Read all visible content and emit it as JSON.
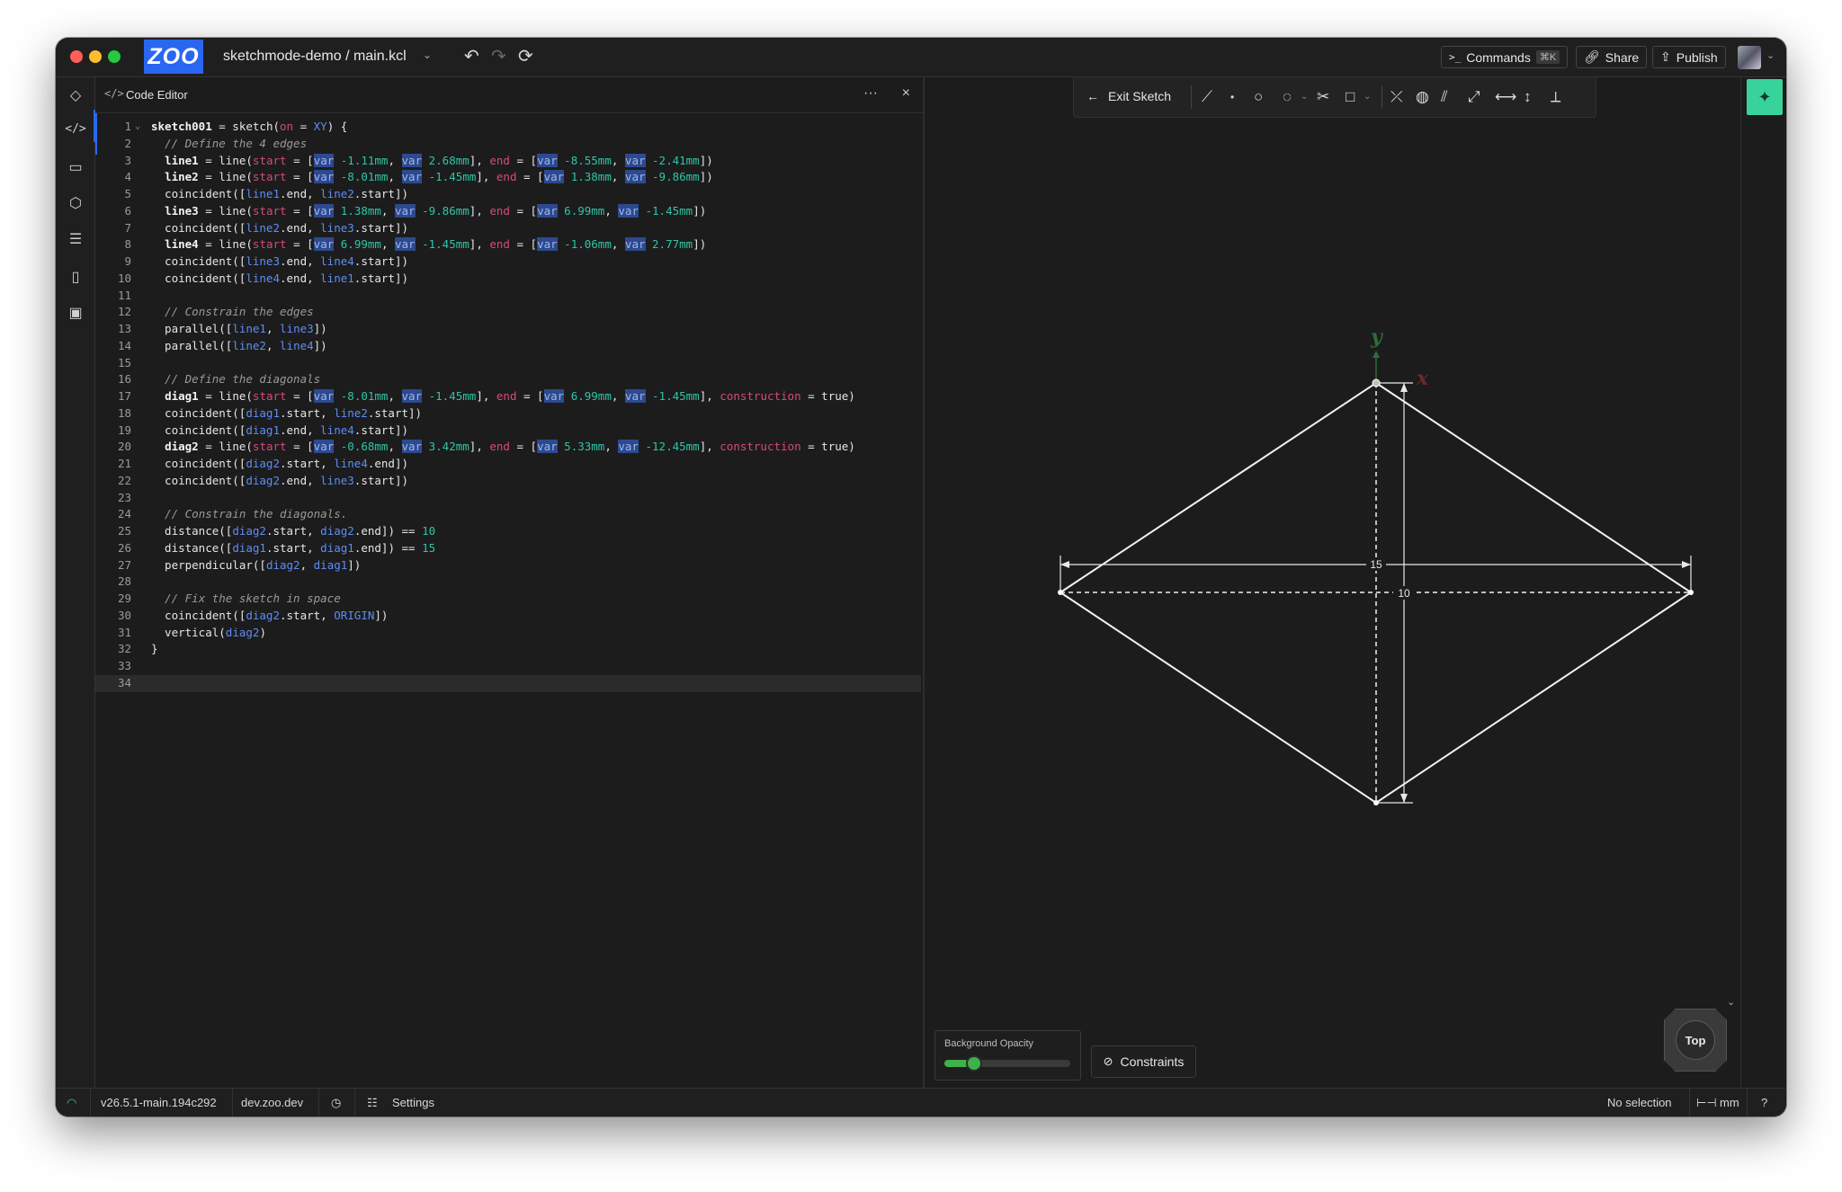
{
  "titlebar": {
    "logo": "ZOO",
    "project_path": "sketchmode-demo / main.kcl",
    "commands_label": "Commands",
    "commands_shortcut": "⌘K",
    "share_label": "Share",
    "publish_label": "Publish"
  },
  "editor": {
    "title": "Code Editor",
    "more": "···",
    "close": "×",
    "lines": [
      {
        "n": "1",
        "fold": "⌄",
        "tokens": [
          [
            "k-name",
            "sketch001"
          ],
          [
            "",
            " = sketch("
          ],
          [
            "k-param",
            "on"
          ],
          [
            "",
            " = "
          ],
          [
            "k-ref",
            "XY"
          ],
          [
            "",
            ") {"
          ]
        ]
      },
      {
        "n": "2",
        "tokens": [
          [
            "",
            "  "
          ],
          [
            "k-com",
            "// Define the 4 edges"
          ]
        ]
      },
      {
        "n": "3",
        "tokens": [
          [
            "",
            "  "
          ],
          [
            "k-name",
            "line1"
          ],
          [
            "",
            " = line("
          ],
          [
            "k-param",
            "start"
          ],
          [
            "",
            " = ["
          ],
          [
            "k-var",
            "var"
          ],
          [
            "k-num",
            " -1.11mm"
          ],
          [
            "",
            ", "
          ],
          [
            "k-var",
            "var"
          ],
          [
            "k-num",
            " 2.68mm"
          ],
          [
            "",
            "], "
          ],
          [
            "k-param",
            "end"
          ],
          [
            "",
            " = ["
          ],
          [
            "k-var",
            "var"
          ],
          [
            "k-num",
            " -8.55mm"
          ],
          [
            "",
            ", "
          ],
          [
            "k-var",
            "var"
          ],
          [
            "k-num",
            " -2.41mm"
          ],
          [
            "",
            "])"
          ]
        ]
      },
      {
        "n": "4",
        "tokens": [
          [
            "",
            "  "
          ],
          [
            "k-name",
            "line2"
          ],
          [
            "",
            " = line("
          ],
          [
            "k-param",
            "start"
          ],
          [
            "",
            " = ["
          ],
          [
            "k-var",
            "var"
          ],
          [
            "k-num",
            " -8.01mm"
          ],
          [
            "",
            ", "
          ],
          [
            "k-var",
            "var"
          ],
          [
            "k-num",
            " -1.45mm"
          ],
          [
            "",
            "], "
          ],
          [
            "k-param",
            "end"
          ],
          [
            "",
            " = ["
          ],
          [
            "k-var",
            "var"
          ],
          [
            "k-num",
            " 1.38mm"
          ],
          [
            "",
            ", "
          ],
          [
            "k-var",
            "var"
          ],
          [
            "k-num",
            " -9.86mm"
          ],
          [
            "",
            "])"
          ]
        ]
      },
      {
        "n": "5",
        "tokens": [
          [
            "",
            "  coincident(["
          ],
          [
            "k-ref",
            "line1"
          ],
          [
            "",
            ".end, "
          ],
          [
            "k-ref",
            "line2"
          ],
          [
            "",
            ".start])"
          ]
        ]
      },
      {
        "n": "6",
        "tokens": [
          [
            "",
            "  "
          ],
          [
            "k-name",
            "line3"
          ],
          [
            "",
            " = line("
          ],
          [
            "k-param",
            "start"
          ],
          [
            "",
            " = ["
          ],
          [
            "k-var",
            "var"
          ],
          [
            "k-num",
            " 1.38mm"
          ],
          [
            "",
            ", "
          ],
          [
            "k-var",
            "var"
          ],
          [
            "k-num",
            " -9.86mm"
          ],
          [
            "",
            "], "
          ],
          [
            "k-param",
            "end"
          ],
          [
            "",
            " = ["
          ],
          [
            "k-var",
            "var"
          ],
          [
            "k-num",
            " 6.99mm"
          ],
          [
            "",
            ", "
          ],
          [
            "k-var",
            "var"
          ],
          [
            "k-num",
            " -1.45mm"
          ],
          [
            "",
            "])"
          ]
        ]
      },
      {
        "n": "7",
        "tokens": [
          [
            "",
            "  coincident(["
          ],
          [
            "k-ref",
            "line2"
          ],
          [
            "",
            ".end, "
          ],
          [
            "k-ref",
            "line3"
          ],
          [
            "",
            ".start])"
          ]
        ]
      },
      {
        "n": "8",
        "tokens": [
          [
            "",
            "  "
          ],
          [
            "k-name",
            "line4"
          ],
          [
            "",
            " = line("
          ],
          [
            "k-param",
            "start"
          ],
          [
            "",
            " = ["
          ],
          [
            "k-var",
            "var"
          ],
          [
            "k-num",
            " 6.99mm"
          ],
          [
            "",
            ", "
          ],
          [
            "k-var",
            "var"
          ],
          [
            "k-num",
            " -1.45mm"
          ],
          [
            "",
            "], "
          ],
          [
            "k-param",
            "end"
          ],
          [
            "",
            " = ["
          ],
          [
            "k-var",
            "var"
          ],
          [
            "k-num",
            " -1.06mm"
          ],
          [
            "",
            ", "
          ],
          [
            "k-var",
            "var"
          ],
          [
            "k-num",
            " 2.77mm"
          ],
          [
            "",
            "])"
          ]
        ]
      },
      {
        "n": "9",
        "tokens": [
          [
            "",
            "  coincident(["
          ],
          [
            "k-ref",
            "line3"
          ],
          [
            "",
            ".end, "
          ],
          [
            "k-ref",
            "line4"
          ],
          [
            "",
            ".start])"
          ]
        ]
      },
      {
        "n": "10",
        "tokens": [
          [
            "",
            "  coincident(["
          ],
          [
            "k-ref",
            "line4"
          ],
          [
            "",
            ".end, "
          ],
          [
            "k-ref",
            "line1"
          ],
          [
            "",
            ".start])"
          ]
        ]
      },
      {
        "n": "11",
        "tokens": []
      },
      {
        "n": "12",
        "tokens": [
          [
            "",
            "  "
          ],
          [
            "k-com",
            "// Constrain the edges"
          ]
        ]
      },
      {
        "n": "13",
        "tokens": [
          [
            "",
            "  parallel(["
          ],
          [
            "k-ref",
            "line1"
          ],
          [
            "",
            ", "
          ],
          [
            "k-ref",
            "line3"
          ],
          [
            "",
            "])"
          ]
        ]
      },
      {
        "n": "14",
        "tokens": [
          [
            "",
            "  parallel(["
          ],
          [
            "k-ref",
            "line2"
          ],
          [
            "",
            ", "
          ],
          [
            "k-ref",
            "line4"
          ],
          [
            "",
            "])"
          ]
        ]
      },
      {
        "n": "15",
        "tokens": []
      },
      {
        "n": "16",
        "tokens": [
          [
            "",
            "  "
          ],
          [
            "k-com",
            "// Define the diagonals"
          ]
        ]
      },
      {
        "n": "17",
        "tokens": [
          [
            "",
            "  "
          ],
          [
            "k-name",
            "diag1"
          ],
          [
            "",
            " = line("
          ],
          [
            "k-param",
            "start"
          ],
          [
            "",
            " = ["
          ],
          [
            "k-var",
            "var"
          ],
          [
            "k-num",
            " -8.01mm"
          ],
          [
            "",
            ", "
          ],
          [
            "k-var",
            "var"
          ],
          [
            "k-num",
            " -1.45mm"
          ],
          [
            "",
            "], "
          ],
          [
            "k-param",
            "end"
          ],
          [
            "",
            " = ["
          ],
          [
            "k-var",
            "var"
          ],
          [
            "k-num",
            " 6.99mm"
          ],
          [
            "",
            ", "
          ],
          [
            "k-var",
            "var"
          ],
          [
            "k-num",
            " -1.45mm"
          ],
          [
            "",
            "], "
          ],
          [
            "k-param",
            "construction"
          ],
          [
            "",
            " = true)"
          ]
        ]
      },
      {
        "n": "18",
        "tokens": [
          [
            "",
            "  coincident(["
          ],
          [
            "k-ref",
            "diag1"
          ],
          [
            "",
            ".start, "
          ],
          [
            "k-ref",
            "line2"
          ],
          [
            "",
            ".start])"
          ]
        ]
      },
      {
        "n": "19",
        "tokens": [
          [
            "",
            "  coincident(["
          ],
          [
            "k-ref",
            "diag1"
          ],
          [
            "",
            ".end, "
          ],
          [
            "k-ref",
            "line4"
          ],
          [
            "",
            ".start])"
          ]
        ]
      },
      {
        "n": "20",
        "tokens": [
          [
            "",
            "  "
          ],
          [
            "k-name",
            "diag2"
          ],
          [
            "",
            " = line("
          ],
          [
            "k-param",
            "start"
          ],
          [
            "",
            " = ["
          ],
          [
            "k-var",
            "var"
          ],
          [
            "k-num",
            " -0.68mm"
          ],
          [
            "",
            ", "
          ],
          [
            "k-var",
            "var"
          ],
          [
            "k-num",
            " 3.42mm"
          ],
          [
            "",
            "], "
          ],
          [
            "k-param",
            "end"
          ],
          [
            "",
            " = ["
          ],
          [
            "k-var",
            "var"
          ],
          [
            "k-num",
            " 5.33mm"
          ],
          [
            "",
            ", "
          ],
          [
            "k-var",
            "var"
          ],
          [
            "k-num",
            " -12.45mm"
          ],
          [
            "",
            "], "
          ],
          [
            "k-param",
            "construction"
          ],
          [
            "",
            " = true)"
          ]
        ]
      },
      {
        "n": "21",
        "tokens": [
          [
            "",
            "  coincident(["
          ],
          [
            "k-ref",
            "diag2"
          ],
          [
            "",
            ".start, "
          ],
          [
            "k-ref",
            "line4"
          ],
          [
            "",
            ".end])"
          ]
        ]
      },
      {
        "n": "22",
        "tokens": [
          [
            "",
            "  coincident(["
          ],
          [
            "k-ref",
            "diag2"
          ],
          [
            "",
            ".end, "
          ],
          [
            "k-ref",
            "line3"
          ],
          [
            "",
            ".start])"
          ]
        ]
      },
      {
        "n": "23",
        "tokens": []
      },
      {
        "n": "24",
        "tokens": [
          [
            "",
            "  "
          ],
          [
            "k-com",
            "// Constrain the diagonals."
          ]
        ]
      },
      {
        "n": "25",
        "tokens": [
          [
            "",
            "  distance(["
          ],
          [
            "k-ref",
            "diag2"
          ],
          [
            "",
            ".start, "
          ],
          [
            "k-ref",
            "diag2"
          ],
          [
            "",
            ".end]) == "
          ],
          [
            "k-num",
            "10"
          ]
        ]
      },
      {
        "n": "26",
        "tokens": [
          [
            "",
            "  distance(["
          ],
          [
            "k-ref",
            "diag1"
          ],
          [
            "",
            ".start, "
          ],
          [
            "k-ref",
            "diag1"
          ],
          [
            "",
            ".end]) == "
          ],
          [
            "k-num",
            "15"
          ]
        ]
      },
      {
        "n": "27",
        "tokens": [
          [
            "",
            "  perpendicular(["
          ],
          [
            "k-ref",
            "diag2"
          ],
          [
            "",
            ", "
          ],
          [
            "k-ref",
            "diag1"
          ],
          [
            "",
            "])"
          ]
        ]
      },
      {
        "n": "28",
        "tokens": []
      },
      {
        "n": "29",
        "tokens": [
          [
            "",
            "  "
          ],
          [
            "k-com",
            "// Fix the sketch in space"
          ]
        ]
      },
      {
        "n": "30",
        "tokens": [
          [
            "",
            "  coincident(["
          ],
          [
            "k-ref",
            "diag2"
          ],
          [
            "",
            ".start, "
          ],
          [
            "k-ref",
            "ORIGIN"
          ],
          [
            "",
            "])"
          ]
        ]
      },
      {
        "n": "31",
        "tokens": [
          [
            "",
            "  vertical("
          ],
          [
            "k-ref",
            "diag2"
          ],
          [
            "",
            ")"
          ]
        ]
      },
      {
        "n": "32",
        "tokens": [
          [
            "",
            "}"
          ]
        ]
      },
      {
        "n": "33",
        "tokens": []
      },
      {
        "n": "34",
        "tokens": [],
        "current": true
      }
    ]
  },
  "viewport": {
    "exit_sketch_label": "Exit Sketch",
    "axis_y_label": "y",
    "axis_x_label": "x",
    "dim_horizontal_label": "15",
    "dim_vertical_label": "10",
    "background_opacity_label": "Background Opacity",
    "background_opacity_value": 0.18,
    "constraints_label": "Constraints",
    "view_label": "Top"
  },
  "statusbar": {
    "version": "v26.5.1-main.194c292",
    "host": "dev.zoo.dev",
    "settings_label": "Settings",
    "selection": "No selection",
    "units": "mm",
    "help": "?"
  },
  "colors": {
    "brand": "#2a67f0",
    "accent_green": "#38d39a",
    "slider_green": "#3fb14a",
    "background": "#1c1c1c"
  }
}
